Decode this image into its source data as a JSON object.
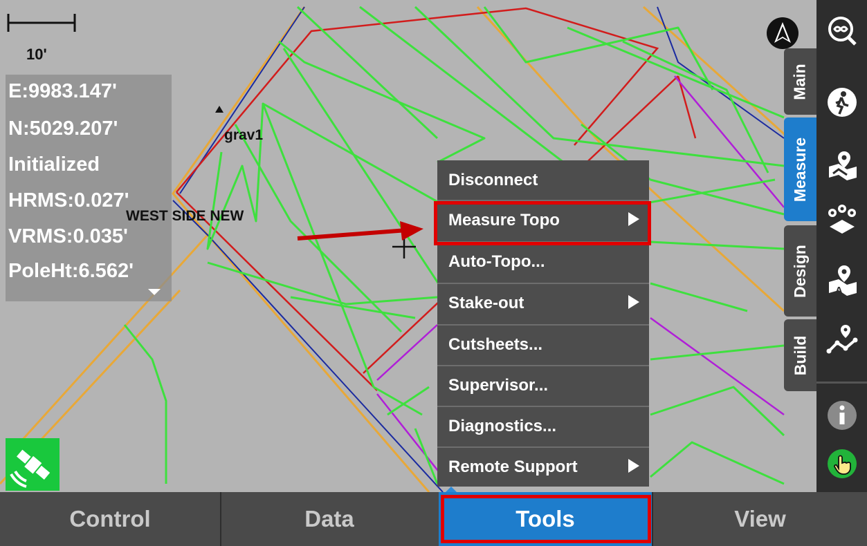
{
  "map": {
    "scale_label": "10'",
    "info": [
      "E:9983.147'",
      "N:5029.207'",
      "Initialized",
      "HRMS:0.027'",
      "VRMS:0.035'",
      "PoleHt:6.562'"
    ],
    "point_label": "grav1",
    "area_label": "WEST SIDE NEW"
  },
  "menu": {
    "items": [
      {
        "label": "Disconnect",
        "submenu": false
      },
      {
        "label": "Measure Topo",
        "submenu": true,
        "highlighted": true
      },
      {
        "label": "Auto-Topo...",
        "submenu": false
      },
      {
        "label": "Stake-out",
        "submenu": true
      },
      {
        "label": "Cutsheets...",
        "submenu": false
      },
      {
        "label": "Supervisor...",
        "submenu": false
      },
      {
        "label": "Diagnostics...",
        "submenu": false
      },
      {
        "label": "Remote Support",
        "submenu": true
      }
    ]
  },
  "side_tabs": [
    {
      "label": "Main",
      "active": false
    },
    {
      "label": "Measure",
      "active": true
    },
    {
      "label": "Design",
      "active": false
    },
    {
      "label": "Build",
      "active": false
    }
  ],
  "right_toolbar": {
    "icons": [
      "zoom-extents-icon",
      "walk-icon",
      "map-point-icon",
      "points-icon",
      "map-text-icon",
      "route-icon",
      "info-icon",
      "touch-icon"
    ]
  },
  "bottom_tabs": [
    {
      "label": "Control",
      "active": false
    },
    {
      "label": "Data",
      "active": false
    },
    {
      "label": "Tools",
      "active": true
    },
    {
      "label": "View",
      "active": false
    }
  ],
  "colors": {
    "accent": "#1e7dcc",
    "highlight": "#e00000",
    "menu_bg": "#4d4d4d",
    "map_bg": "#b4b4b4",
    "gps_status": "#19c83d"
  }
}
